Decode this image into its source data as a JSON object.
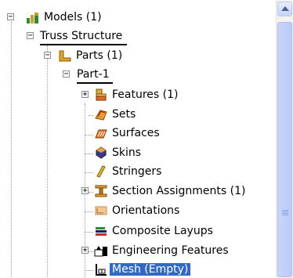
{
  "tree": {
    "models": "Models (1)",
    "truss_structure": "Truss Structure",
    "parts": "Parts (1)",
    "part1": "Part-1",
    "children": [
      {
        "label": "Features (1)",
        "icon": "features-icon",
        "expandable": true
      },
      {
        "label": "Sets",
        "icon": "sets-icon",
        "expandable": false
      },
      {
        "label": "Surfaces",
        "icon": "surfaces-icon",
        "expandable": false
      },
      {
        "label": "Skins",
        "icon": "skins-icon",
        "expandable": false
      },
      {
        "label": "Stringers",
        "icon": "stringers-icon",
        "expandable": false
      },
      {
        "label": "Section Assignments (1)",
        "icon": "section-assignments-icon",
        "expandable": true
      },
      {
        "label": "Orientations",
        "icon": "orientations-icon",
        "expandable": false
      },
      {
        "label": "Composite Layups",
        "icon": "composite-layups-icon",
        "expandable": false
      },
      {
        "label": "Engineering Features",
        "icon": "engineering-features-icon",
        "expandable": true
      },
      {
        "label": "Mesh (Empty)",
        "icon": "mesh-icon",
        "expandable": false,
        "selected": true
      }
    ]
  },
  "colors": {
    "selection": "#316ac5",
    "scrollbar": "#c4d3fb"
  }
}
